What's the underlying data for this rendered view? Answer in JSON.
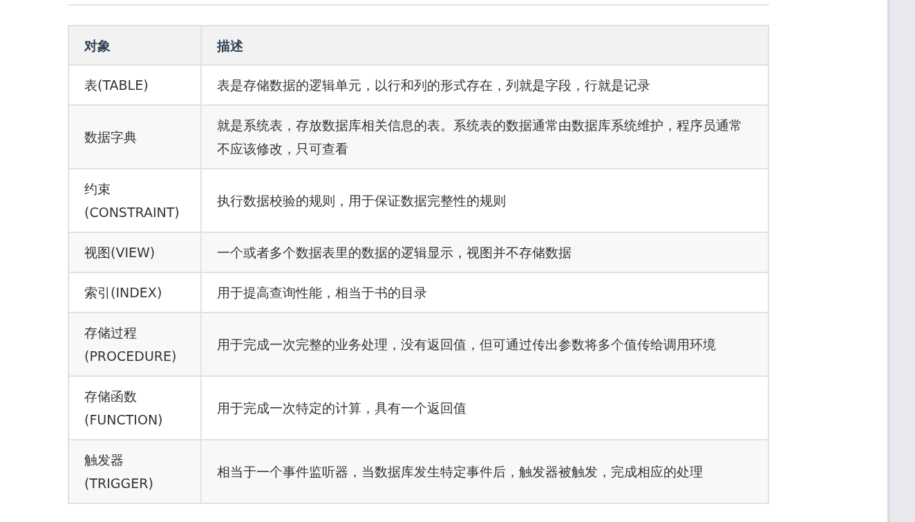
{
  "table": {
    "columns": [
      "对象",
      "描述"
    ],
    "rows": [
      {
        "object": "表(TABLE)",
        "description": "表是存储数据的逻辑单元，以行和列的形式存在，列就是字段，行就是记录"
      },
      {
        "object": "数据字典",
        "description": "就是系统表，存放数据库相关信息的表。系统表的数据通常由数据库系统维护，程序员通常不应该修改，只可查看"
      },
      {
        "object": "约束(CONSTRAINT)",
        "description": "执行数据校验的规则，用于保证数据完整性的规则"
      },
      {
        "object": "视图(VIEW)",
        "description": "一个或者多个数据表里的数据的逻辑显示，视图并不存储数据"
      },
      {
        "object": "索引(INDEX)",
        "description": "用于提高查询性能，相当于书的目录"
      },
      {
        "object": "存储过程(PROCEDURE)",
        "description": "用于完成一次完整的业务处理，没有返回值，但可通过传出参数将多个值传给调用环境"
      },
      {
        "object": "存储函数(FUNCTION)",
        "description": "用于完成一次特定的计算，具有一个返回值"
      },
      {
        "object": "触发器(TRIGGER)",
        "description": "相当于一个事件监听器，当数据库发生特定事件后，触发器被触发，完成相应的处理"
      }
    ]
  }
}
